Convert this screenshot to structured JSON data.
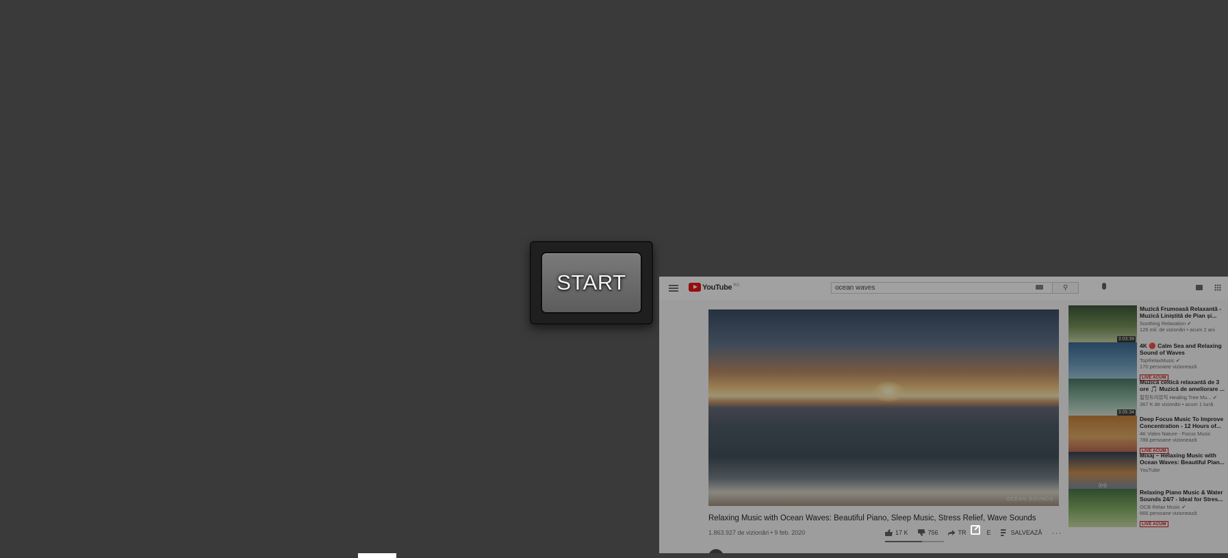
{
  "start_button": {
    "label": "START"
  },
  "youtube": {
    "logo_text": "YouTube",
    "logo_region": "RO",
    "search": {
      "value": "ocean waves"
    },
    "video": {
      "title": "Relaxing Music with Ocean Waves: Beautiful Piano, Sleep Music, Stress Relief, Wave Sounds",
      "views_date": "1.863.927 de vizionări • 9 feb. 2020",
      "watermark": "OCEAN SOUNDS",
      "likes": "17 K",
      "dislikes": "756",
      "share_label": "TR",
      "share_label_tail": "E",
      "save_label": "SALVEAZĂ",
      "more_label": "···"
    },
    "sidebar": [
      {
        "title": "Muzică Frumoasă Relaxantă - Muzică Liniștită de Pian și...",
        "channel": "Soothing Relaxation ✔",
        "views": "126 mil. de vizionări • acum 2 ani",
        "duration": "3:03:39",
        "live": "",
        "thumb_colors": [
          "#2e4a2c",
          "#6b8a4a",
          "#c9d6a8"
        ]
      },
      {
        "title": "4K 🔴 Calm Sea and Relaxing Sound of Waves",
        "channel": "TopRelaxMusic ✔",
        "views": "170 persoane vizionează",
        "duration": "",
        "live": "LIVE ACUM",
        "thumb_colors": [
          "#2d5f8a",
          "#5f93b8",
          "#9fc6dd"
        ]
      },
      {
        "title": "Muzică celtică relaxantă de 3 ore 🎵 Muzică de ameliorare ...",
        "channel": "힐링트리뮤직 Healing Tree Mu... ✔",
        "views": "367 K de vizionări • acum 1 lună",
        "duration": "3:05:34",
        "live": "",
        "thumb_colors": [
          "#3f6e5c",
          "#8ab9a3",
          "#dce7df"
        ]
      },
      {
        "title": "Deep Focus Music To Improve Concentration - 12 Hours of...",
        "channel": "4K Video Nature - Focus Music",
        "views": "786 persoane vizionează",
        "duration": "",
        "live": "LIVE ACUM",
        "thumb_colors": [
          "#c47a2d",
          "#e0a55a",
          "#b3543f"
        ]
      },
      {
        "title": "Mixaj – Relaxing Music with Ocean Waves: Beautiful Pian...",
        "channel": "YouTube",
        "views": "",
        "duration": "",
        "live": "",
        "live_icon": "((•))",
        "thumb_colors": [
          "#1f3550",
          "#c88845",
          "#6b84a3"
        ]
      },
      {
        "title": "Relaxing Piano Music & Water Sounds 24/7 - Ideal for Stres...",
        "channel": "OCB Relax Music ✔",
        "views": "666 persoane vizionează",
        "duration": "",
        "live": "LIVE ACUM",
        "thumb_colors": [
          "#3d6b36",
          "#7fae5c",
          "#c8d9a0"
        ]
      }
    ]
  }
}
